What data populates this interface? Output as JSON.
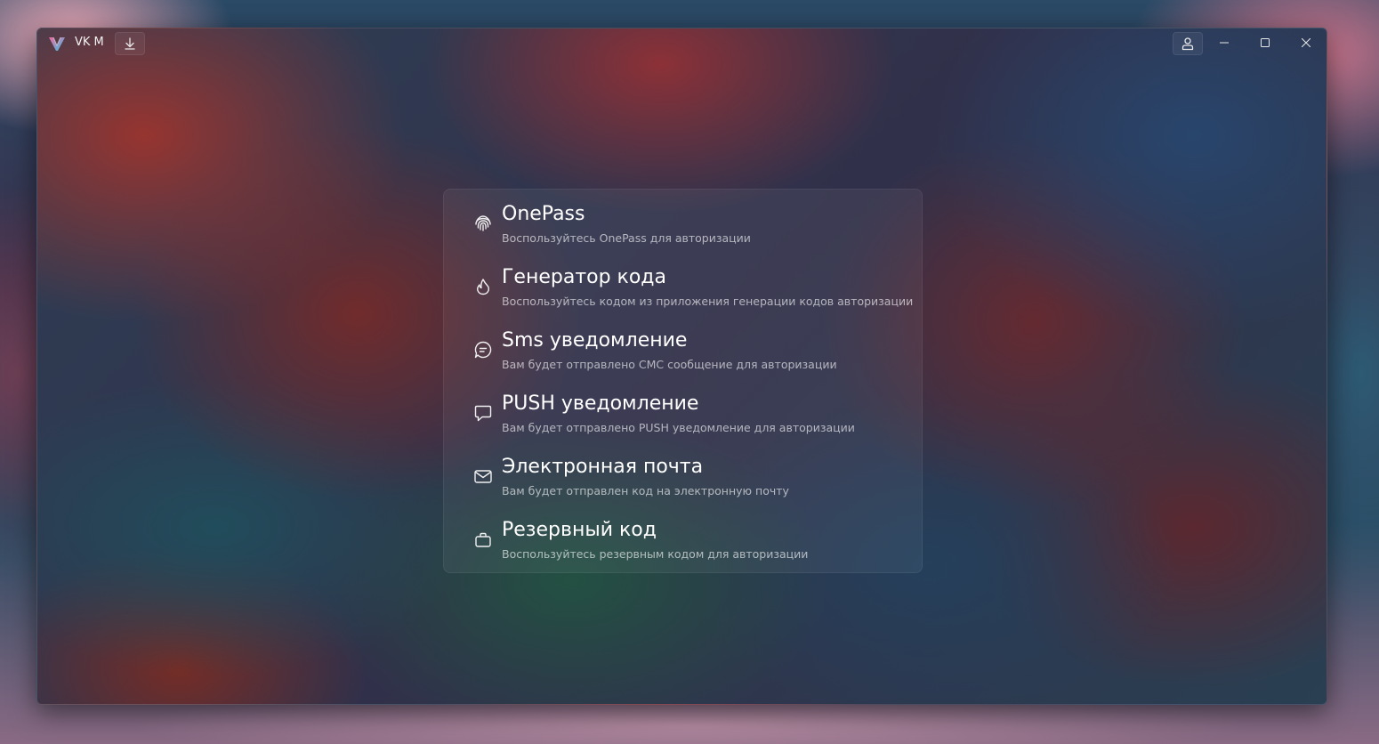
{
  "window": {
    "app_title": "VK M",
    "icons": {
      "logo": "vkm-logo",
      "download": "download-icon",
      "account": "account-icon",
      "minimize": "minimize-icon",
      "maximize": "maximize-icon",
      "close": "close-icon"
    }
  },
  "auth_options": [
    {
      "icon": "fingerprint-icon",
      "title": "OnePass",
      "description": "Воспользуйтесь OnePass для авторизации"
    },
    {
      "icon": "flame-icon",
      "title": "Генератор кода",
      "description": "Воспользуйтесь кодом из приложения генерации кодов авторизации"
    },
    {
      "icon": "chat-bubble-icon",
      "title": "Sms уведомление",
      "description": "Вам будет отправлено СМС сообщение для авторизации"
    },
    {
      "icon": "message-icon",
      "title": "PUSH уведомление",
      "description": "Вам будет отправлено PUSH уведомление для авторизации"
    },
    {
      "icon": "mail-icon",
      "title": "Электронная почта",
      "description": "Вам будет отправлен код на электронную почту"
    },
    {
      "icon": "briefcase-icon",
      "title": "Резервный код",
      "description": "Воспользуйтесь резервным кодом для авторизации"
    }
  ],
  "colors": {
    "text_primary": "#ffffff",
    "text_secondary": "#a7a7a7",
    "logo_gradient_start": "#f16aa0",
    "logo_gradient_end": "#39c1e8"
  }
}
